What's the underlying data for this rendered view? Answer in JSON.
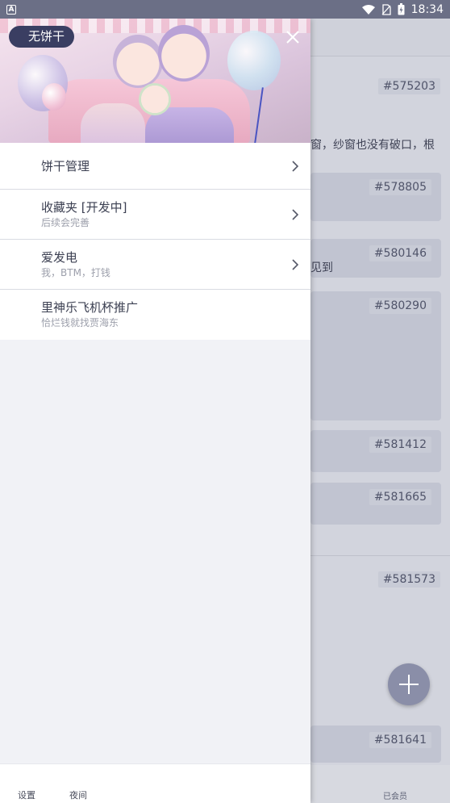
{
  "status_bar": {
    "time": "18:34",
    "left_icon": "A"
  },
  "drawer": {
    "cookie_label": "无饼干",
    "menu": [
      {
        "title": "饼干管理",
        "subtitle": "",
        "has_arrow": true
      },
      {
        "title": "收藏夹 [开发中]",
        "subtitle": "后续会完善",
        "has_arrow": true
      },
      {
        "title": "爱发电",
        "subtitle": "我，BTM，打钱",
        "has_arrow": true
      },
      {
        "title": "里神乐飞机杯推广",
        "subtitle": "恰烂钱就找贾海东",
        "has_arrow": false
      }
    ],
    "footer": {
      "settings": "设置",
      "night": "夜间"
    }
  },
  "background": {
    "ids": [
      "#575203",
      "#578805",
      "#580146",
      "#580290",
      "#581412",
      "#581665",
      "#581573",
      "#581641"
    ],
    "text_line1": "窗，纱窗也没有破口，根",
    "text_line2": "见到",
    "bottom_label": "已会员"
  },
  "colors": {
    "accent": "#3a3e62",
    "fab": "#8a8ea8"
  }
}
